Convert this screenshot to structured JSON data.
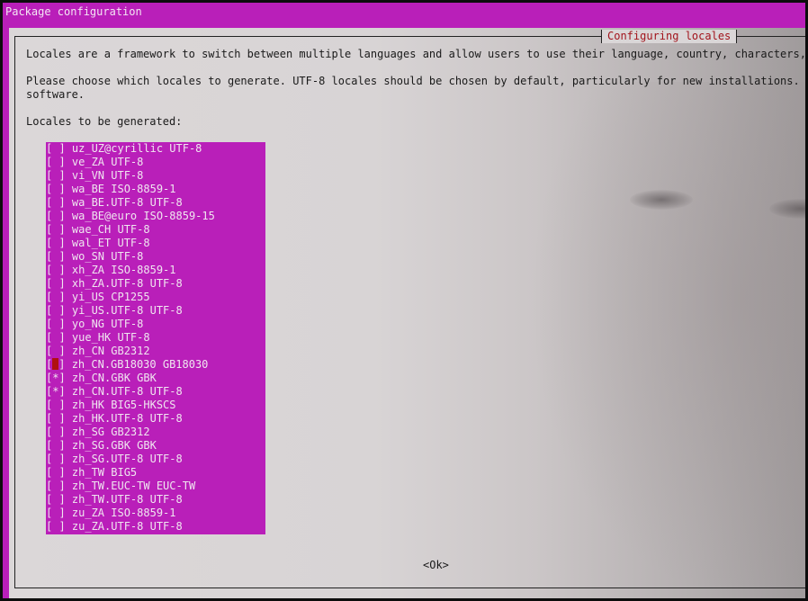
{
  "window": {
    "title": "Package configuration"
  },
  "dialog": {
    "title": "Configuring locales",
    "intro_line": "Locales are a framework to switch between multiple languages and allow users to use their language, country, characters, col",
    "choose_line1": "Please choose which locales to generate. UTF-8 locales should be chosen by default, particularly for new installations. Othe",
    "choose_line2": "software.",
    "list_label": "Locales to be generated:",
    "ok_label": "<Ok>"
  },
  "locales": [
    {
      "mark": "[ ]",
      "name": "uz_UZ@cyrillic UTF-8",
      "checked": false
    },
    {
      "mark": "[ ]",
      "name": "ve_ZA UTF-8",
      "checked": false
    },
    {
      "mark": "[ ]",
      "name": "vi_VN UTF-8",
      "checked": false
    },
    {
      "mark": "[ ]",
      "name": "wa_BE ISO-8859-1",
      "checked": false
    },
    {
      "mark": "[ ]",
      "name": "wa_BE.UTF-8 UTF-8",
      "checked": false
    },
    {
      "mark": "[ ]",
      "name": "wa_BE@euro ISO-8859-15",
      "checked": false
    },
    {
      "mark": "[ ]",
      "name": "wae_CH UTF-8",
      "checked": false
    },
    {
      "mark": "[ ]",
      "name": "wal_ET UTF-8",
      "checked": false
    },
    {
      "mark": "[ ]",
      "name": "wo_SN UTF-8",
      "checked": false
    },
    {
      "mark": "[ ]",
      "name": "xh_ZA ISO-8859-1",
      "checked": false
    },
    {
      "mark": "[ ]",
      "name": "xh_ZA.UTF-8 UTF-8",
      "checked": false
    },
    {
      "mark": "[ ]",
      "name": "yi_US CP1255",
      "checked": false
    },
    {
      "mark": "[ ]",
      "name": "yi_US.UTF-8 UTF-8",
      "checked": false
    },
    {
      "mark": "[ ]",
      "name": "yo_NG UTF-8",
      "checked": false
    },
    {
      "mark": "[ ]",
      "name": "yue_HK UTF-8",
      "checked": false
    },
    {
      "mark": "[ ]",
      "name": "zh_CN GB2312",
      "checked": false
    },
    {
      "mark": "[ ]",
      "name": "zh_CN.GB18030 GB18030",
      "checked": false,
      "cursor": true
    },
    {
      "mark": "[*]",
      "name": "zh_CN.GBK GBK",
      "checked": true
    },
    {
      "mark": "[*]",
      "name": "zh_CN.UTF-8 UTF-8",
      "checked": true
    },
    {
      "mark": "[ ]",
      "name": "zh_HK BIG5-HKSCS",
      "checked": false
    },
    {
      "mark": "[ ]",
      "name": "zh_HK.UTF-8 UTF-8",
      "checked": false
    },
    {
      "mark": "[ ]",
      "name": "zh_SG GB2312",
      "checked": false
    },
    {
      "mark": "[ ]",
      "name": "zh_SG.GBK GBK",
      "checked": false
    },
    {
      "mark": "[ ]",
      "name": "zh_SG.UTF-8 UTF-8",
      "checked": false
    },
    {
      "mark": "[ ]",
      "name": "zh_TW BIG5",
      "checked": false
    },
    {
      "mark": "[ ]",
      "name": "zh_TW.EUC-TW EUC-TW",
      "checked": false
    },
    {
      "mark": "[ ]",
      "name": "zh_TW.UTF-8 UTF-8",
      "checked": false
    },
    {
      "mark": "[ ]",
      "name": "zu_ZA ISO-8859-1",
      "checked": false
    },
    {
      "mark": "[ ]",
      "name": "zu_ZA.UTF-8 UTF-8",
      "checked": false
    }
  ],
  "colors": {
    "terminal_bg": "#b91fb9",
    "dialog_bg": "#dad6d7",
    "title_red": "#a2141c",
    "list_text": "#f0e6f0",
    "cursor_red": "#b01010"
  }
}
